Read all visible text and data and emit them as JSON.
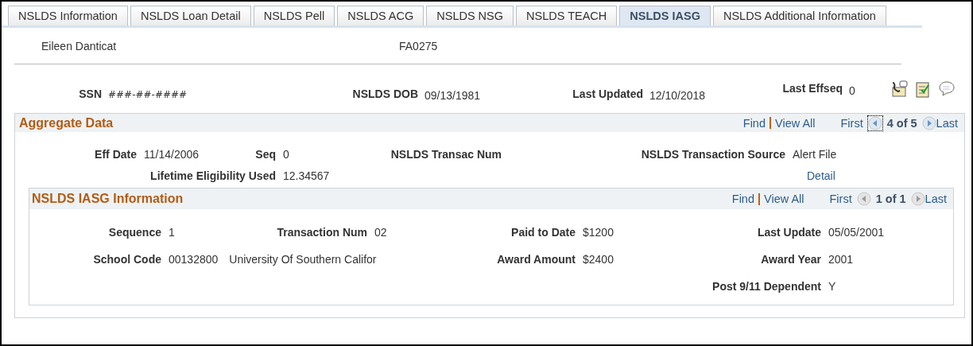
{
  "tabs": [
    {
      "label": "NSLDS Information",
      "selected": false
    },
    {
      "label": "NSLDS Loan Detail",
      "selected": false
    },
    {
      "label": "NSLDS Pell",
      "selected": false
    },
    {
      "label": "NSLDS ACG",
      "selected": false
    },
    {
      "label": "NSLDS NSG",
      "selected": false
    },
    {
      "label": "NSLDS TEACH",
      "selected": false
    },
    {
      "label": "NSLDS IASG",
      "selected": true
    },
    {
      "label": "NSLDS Additional Information",
      "selected": false
    }
  ],
  "student": {
    "name": "Eileen Danticat",
    "id": "FA0275"
  },
  "summary": {
    "ssn_label": "SSN",
    "ssn": "###-##-####",
    "dob_label": "NSLDS DOB",
    "dob": "09/13/1981",
    "updated_label": "Last Updated",
    "updated": "12/10/2018",
    "effseq_label": "Last Effseq",
    "effseq": "0"
  },
  "aggregate": {
    "title": "Aggregate Data",
    "find": "Find",
    "view_all": "View All",
    "first": "First",
    "position": "4 of 5",
    "last": "Last",
    "previous": {
      "disabled": false,
      "focused": true
    },
    "next": {
      "disabled": false
    },
    "rows": [
      [
        {
          "label": "Eff Date",
          "value": "11/14/2006"
        },
        {
          "label": "Seq",
          "value": "0"
        },
        {
          "label": "NSLDS Transac Num"
        },
        {
          "label": "NSLDS Transaction Source",
          "value": "Alert File"
        }
      ],
      [
        {},
        {
          "label": "Lifetime Eligibility Used",
          "value": "12.34567"
        },
        {},
        {
          "link": "Detail"
        }
      ]
    ],
    "iasg": {
      "title": "NSLDS IASG Information",
      "find": "Find",
      "view_all": "View All",
      "first": "First",
      "position": "1 of 1",
      "last": "Last",
      "previous": {
        "disabled": true,
        "focused": false
      },
      "next": {
        "disabled": true
      },
      "rows": [
        [
          {
            "label": "Sequence",
            "value": "1"
          },
          {
            "label": "Transaction Num",
            "value": "02"
          },
          {
            "label": "Paid to Date",
            "value": "$1200"
          },
          {
            "label": "Last Update",
            "value": "05/05/2001"
          }
        ],
        [
          {
            "label": "School Code",
            "value": "00132800",
            "extra": "University Of Southern Califor"
          },
          {},
          {
            "label": "Award Amount",
            "value": "$2400"
          },
          {
            "label": "Award Year",
            "value": "2001"
          }
        ],
        [
          {},
          {},
          {},
          {
            "label": "Post 9/11 Dependent",
            "value": "Y"
          }
        ]
      ]
    }
  }
}
